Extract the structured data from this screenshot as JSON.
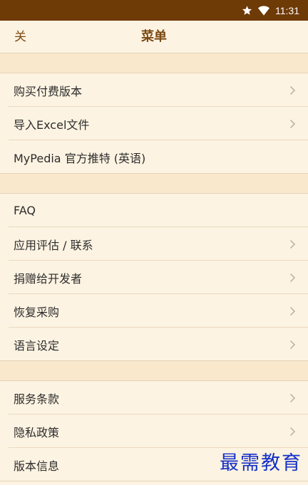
{
  "status_bar": {
    "time": "11:31",
    "icons": [
      "star-icon",
      "wifi-icon",
      "battery-icon"
    ]
  },
  "header": {
    "close_label": "关",
    "title": "菜单"
  },
  "groups": [
    {
      "items": [
        {
          "label": "购买付费版本",
          "chevron": true
        },
        {
          "label": "导入Excel文件",
          "chevron": true
        },
        {
          "label": "MyPedia 官方推特 (英语)",
          "chevron": false
        }
      ]
    },
    {
      "items": [
        {
          "label": "FAQ",
          "chevron": false
        },
        {
          "label": "应用评估 / 联系",
          "chevron": true
        },
        {
          "label": "捐赠给开发者",
          "chevron": true
        },
        {
          "label": "恢复采购",
          "chevron": true
        },
        {
          "label": "语言设定",
          "chevron": true
        }
      ]
    },
    {
      "items": [
        {
          "label": "服务条款",
          "chevron": true
        },
        {
          "label": "隐私政策",
          "chevron": true
        },
        {
          "label": "版本信息",
          "chevron": false
        }
      ]
    }
  ],
  "watermark": "最需教育",
  "colors": {
    "status_bar_bg": "#6e3a06",
    "header_text": "#7a4a14",
    "background": "#fdf3e2",
    "section_separator": "#fae8cd",
    "watermark": "#1530c8"
  }
}
